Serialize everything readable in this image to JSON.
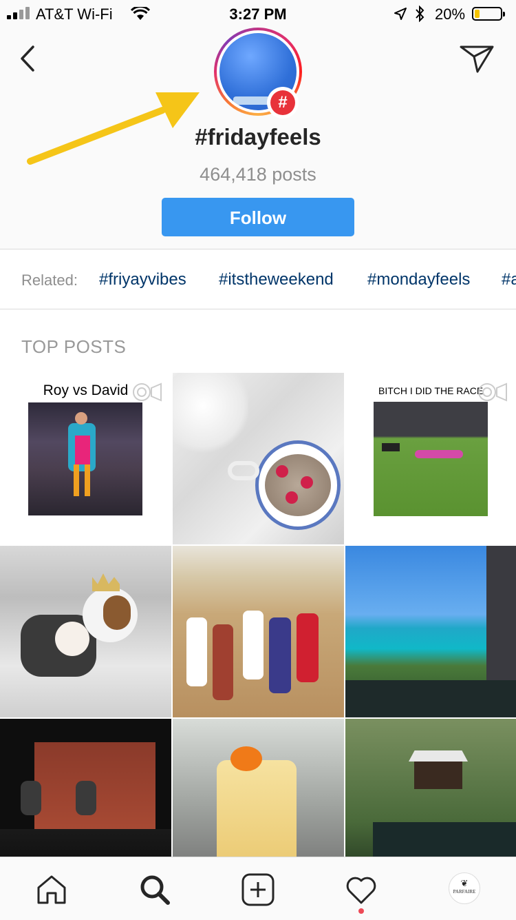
{
  "status_bar": {
    "carrier": "AT&T Wi-Fi",
    "time": "3:27 PM",
    "battery_percent": "20%",
    "battery_level": 0.2,
    "icons": [
      "signal-bars-icon",
      "wifi-icon",
      "location-arrow-icon",
      "bluetooth-icon",
      "battery-icon"
    ]
  },
  "header": {
    "hashtag": "#fridayfeels",
    "post_count": "464,418 posts",
    "follow_label": "Follow",
    "badge_symbol": "#",
    "icons": [
      "back-chevron-icon",
      "direct-send-icon",
      "hashtag-badge-icon"
    ]
  },
  "related": {
    "label": "Related:",
    "tags": [
      "#friyayvibes",
      "#itstheweekend",
      "#mondayfeels",
      "#a"
    ]
  },
  "top_posts": {
    "title": "TOP POSTS",
    "posts": [
      {
        "caption": "Roy vs David",
        "kind": "video"
      },
      {
        "caption": "",
        "kind": "photo"
      },
      {
        "caption": "BITCH I DID THE RACE",
        "kind": "video"
      },
      {
        "caption": "",
        "kind": "photo"
      },
      {
        "caption": "",
        "kind": "photo"
      },
      {
        "caption": "",
        "kind": "photo"
      },
      {
        "caption": "",
        "kind": "photo"
      },
      {
        "caption": "",
        "kind": "photo"
      },
      {
        "caption": "",
        "kind": "photo"
      }
    ]
  },
  "bottom_nav": {
    "items": [
      "home-icon",
      "search-icon",
      "new-post-icon",
      "activity-heart-icon",
      "profile-avatar"
    ],
    "active": "search-icon",
    "profile_text": "PARFAIRE"
  },
  "colors": {
    "follow_blue": "#3897f0",
    "hashtag_link": "#003569",
    "arrow_yellow": "#f5c518",
    "badge_red": "#e8323a",
    "notification_dot": "#ed4956"
  }
}
